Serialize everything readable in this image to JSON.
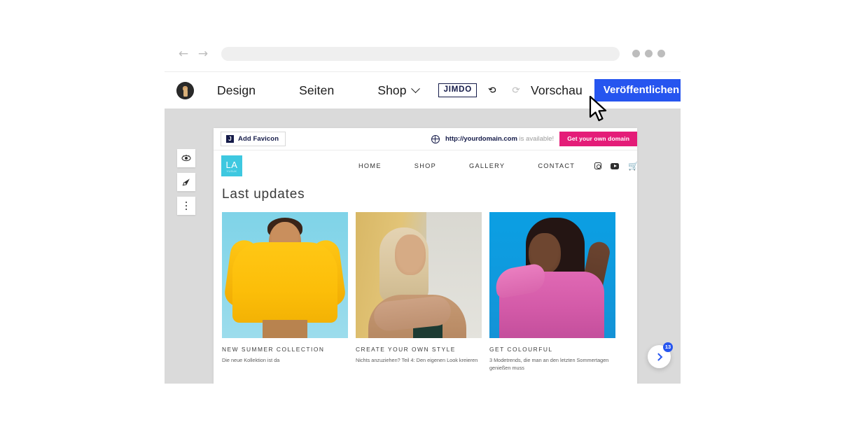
{
  "browser": {
    "back_icon": "arrow-left-icon",
    "forward_icon": "arrow-right-icon",
    "url_value": "",
    "url_placeholder": "",
    "window_dots": 3
  },
  "editor_toolbar": {
    "avatar_label": "",
    "design_label": "Design",
    "seiten_label": "Seiten",
    "shop_label": "Shop",
    "shop_chevron_icon": "chevron-down-icon",
    "brand_label": "JIMDO",
    "undo_icon": "undo-icon",
    "redo_icon": "redo-icon",
    "preview_label": "Vorschau",
    "publish_label": "Veröffentlichen",
    "publish_color": "#2655ef",
    "more_icon": "kebab-menu-icon"
  },
  "tool_rail": {
    "items": [
      {
        "name": "eye-icon",
        "glyph": "◉"
      },
      {
        "name": "brush-icon",
        "glyph": "◥"
      },
      {
        "name": "kebab-menu-icon",
        "glyph": ""
      }
    ]
  },
  "favicon_bar": {
    "favicon_badge": "J",
    "add_favicon_label": "Add Favicon",
    "globe_icon": "globe-icon",
    "domain_name": "http://yourdomain.com",
    "domain_status": " is available!",
    "get_domain_label": "Get your own domain",
    "get_domain_color": "#e41c78"
  },
  "site": {
    "logo": {
      "initials": "LA",
      "subtitle": "YUSUK",
      "color": "#3ec8e0"
    },
    "nav_links": [
      "HOME",
      "SHOP",
      "GALLERY",
      "CONTACT"
    ],
    "nav_icons": [
      {
        "name": "instagram-icon"
      },
      {
        "name": "youtube-icon"
      },
      {
        "name": "cart-icon",
        "glyph": "🛒"
      }
    ],
    "section_title": "Last updates",
    "cards": [
      {
        "title": "NEW SUMMER COLLECTION",
        "desc": "Die neue Kollektion ist da",
        "image_alt": "woman-in-yellow-hoodie"
      },
      {
        "title": "CREATE YOUR OWN STYLE",
        "desc": "Nichts anzuziehen? Teil 4: Den eigenen Look kreieren",
        "image_alt": "blonde-woman-portrait"
      },
      {
        "title": "GET COLOURFUL",
        "desc": "3 Modetrends, die man an den letzten Sommertagen genießen muss",
        "image_alt": "woman-in-pink-dress"
      }
    ],
    "bottom_bars": [
      {
        "color": "#179fbd"
      },
      {
        "color": "#9d86bb"
      }
    ]
  },
  "chat_widget": {
    "chevron_icon": "chevron-right-icon",
    "badge_count": "13",
    "badge_color": "#2655ef"
  },
  "cursor": {
    "icon": "mouse-pointer-icon"
  }
}
